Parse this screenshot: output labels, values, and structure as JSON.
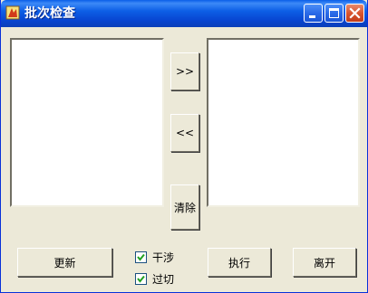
{
  "window": {
    "title": "批次检查"
  },
  "titlebar": {
    "app_icon": "app-icon",
    "minimize_icon": "minimize-icon",
    "maximize_icon": "maximize-icon",
    "close_icon": "close-icon"
  },
  "transfer": {
    "add_label": ">>",
    "remove_label": "<<",
    "clear_label": "清除"
  },
  "actions": {
    "refresh_label": "更新",
    "execute_label": "执行",
    "exit_label": "离开"
  },
  "options": [
    {
      "label": "干涉",
      "checked": true
    },
    {
      "label": "过切",
      "checked": true
    }
  ],
  "colors": {
    "titlebar": "#0a5ee8",
    "face": "#ece9d8",
    "close": "#d9552f"
  }
}
